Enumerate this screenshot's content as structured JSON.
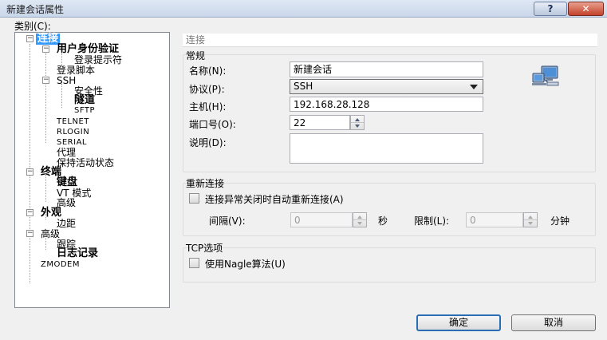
{
  "window": {
    "title": "新建会话属性",
    "help_label": "?",
    "close_label": "✕"
  },
  "category": {
    "label": "类别(C):"
  },
  "tree": [
    {
      "label": "连接",
      "selected": true
    },
    {
      "label": "用户身份验证"
    },
    {
      "label": "登录提示符"
    },
    {
      "label": "登录脚本"
    },
    {
      "label": "SSH"
    },
    {
      "label": "安全性"
    },
    {
      "label": "隧道"
    },
    {
      "label": "SFTP"
    },
    {
      "label": "TELNET"
    },
    {
      "label": "RLOGIN"
    },
    {
      "label": "SERIAL"
    },
    {
      "label": "代理"
    },
    {
      "label": "保持活动状态"
    },
    {
      "label": "终端"
    },
    {
      "label": "键盘"
    },
    {
      "label": "VT 模式"
    },
    {
      "label": "高级"
    },
    {
      "label": "外观"
    },
    {
      "label": "边距"
    },
    {
      "label": "高级"
    },
    {
      "label": "跟踪"
    },
    {
      "label": "日志记录"
    },
    {
      "label": "ZMODEM"
    }
  ],
  "panel": {
    "header": "连接",
    "general": {
      "title": "常规",
      "name_label": "名称(N):",
      "name_value": "新建会话",
      "protocol_label": "协议(P):",
      "protocol_value": "SSH",
      "host_label": "主机(H):",
      "host_value": "192.168.28.128",
      "port_label": "端口号(O):",
      "port_value": "22",
      "desc_label": "说明(D):",
      "desc_value": ""
    },
    "reconnect": {
      "title": "重新连接",
      "auto_label": "连接异常关闭时自动重新连接(A)",
      "interval_label": "间隔(V):",
      "interval_value": "0",
      "interval_unit": "秒",
      "limit_label": "限制(L):",
      "limit_value": "0",
      "limit_unit": "分钟"
    },
    "tcp": {
      "title": "TCP选项",
      "nagle_label": "使用Nagle算法(U)"
    }
  },
  "buttons": {
    "ok": "确定",
    "cancel": "取消"
  },
  "colors": {
    "selection": "#3399ff",
    "default_button_border": "#2b6db5"
  }
}
